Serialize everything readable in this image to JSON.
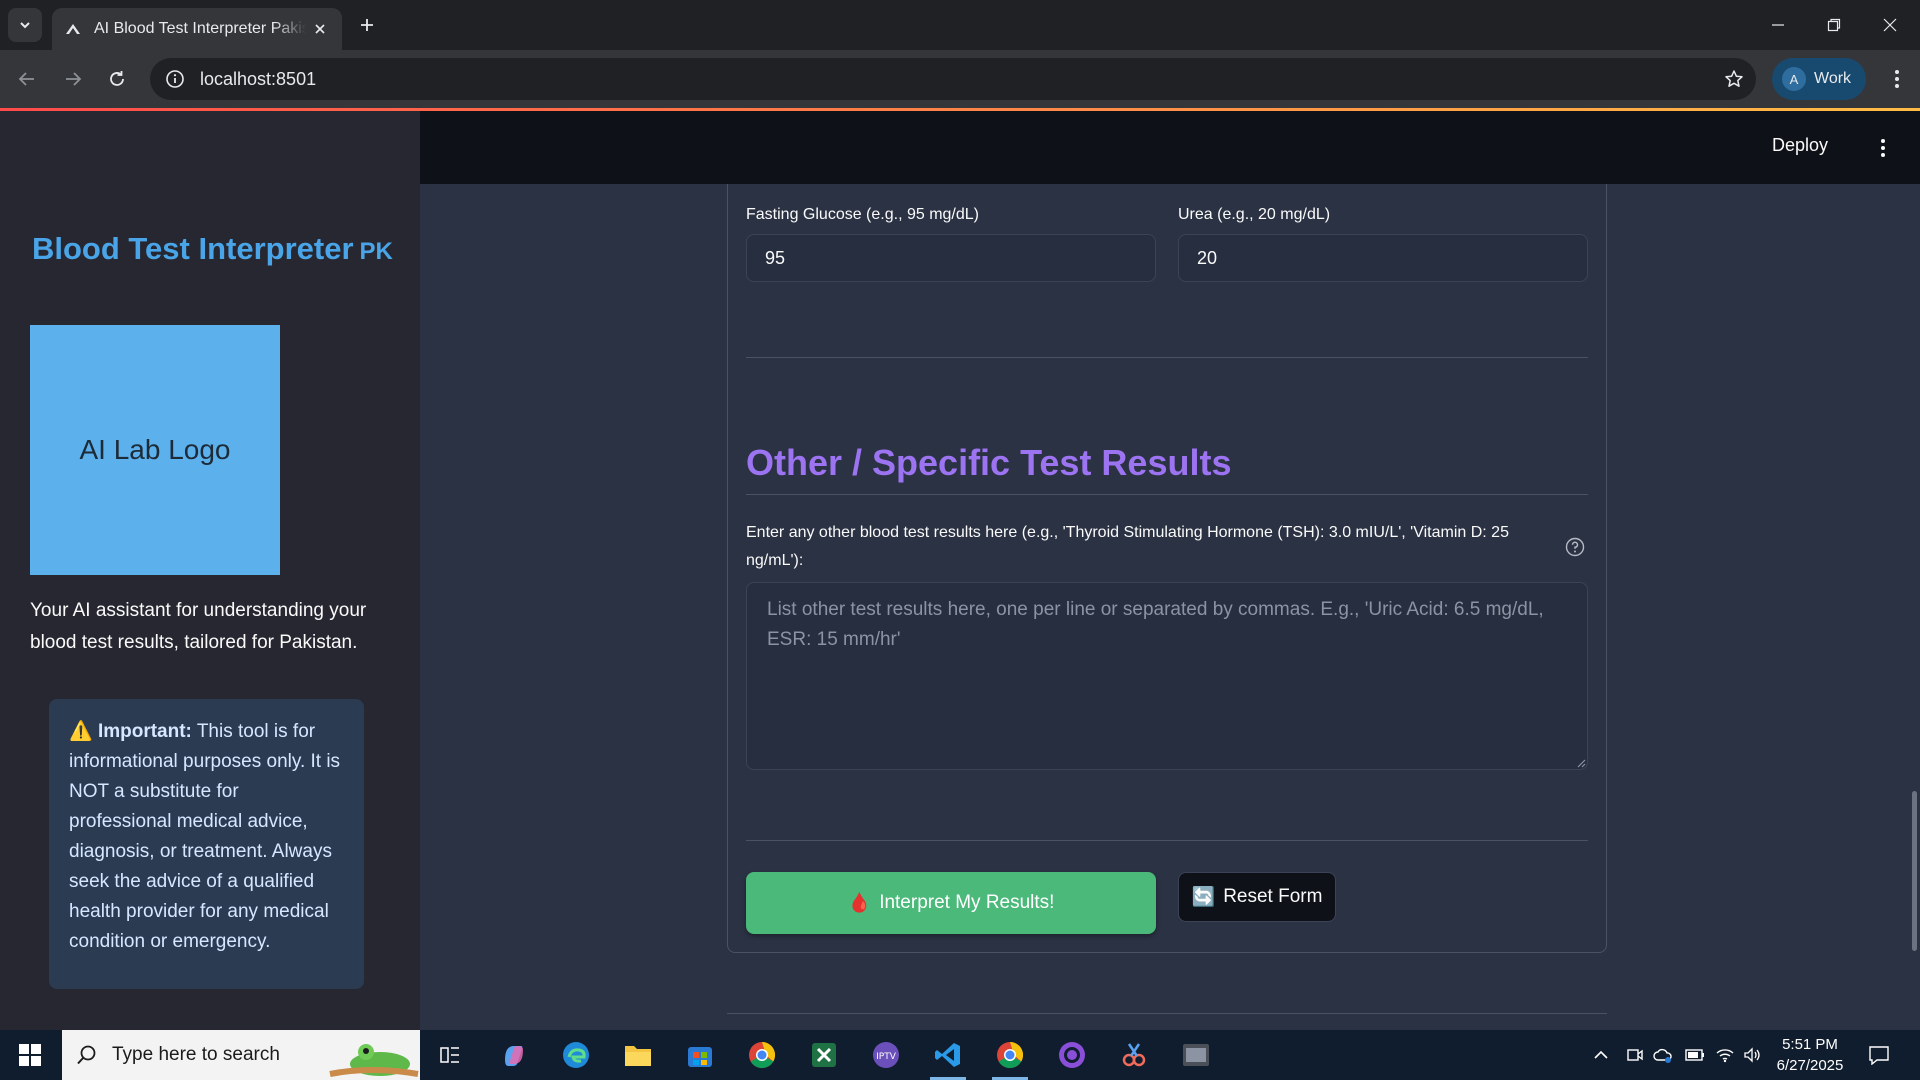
{
  "browser": {
    "tab_title": "AI Blood Test Interpreter Pakistan",
    "url": "localhost:8501",
    "profile_initial": "A",
    "profile_label": "Work"
  },
  "app_header": {
    "deploy_label": "Deploy"
  },
  "sidebar": {
    "title": "Blood Test Interpreter",
    "title_suffix": "PK",
    "logo_text": "AI Lab Logo",
    "description": "Your AI assistant for understanding your blood test results, tailored for Pakistan.",
    "warning_icon": "⚠️",
    "warning_bold": "Important:",
    "warning_text": "This tool is for informational purposes only. It is NOT a substitute for professional medical advice, diagnosis, or treatment. Always seek the advice of a qualified health provider for any medical condition or emergency."
  },
  "form": {
    "fasting_glucose_label": "Fasting Glucose (e.g., 95 mg/dL)",
    "fasting_glucose_value": "95",
    "urea_label": "Urea (e.g., 20 mg/dL)",
    "urea_value": "20",
    "other_section_title": "Other / Specific Test Results",
    "other_label": "Enter any other blood test results here (e.g., 'Thyroid Stimulating Hormone (TSH): 3.0 mIU/L', 'Vitamin D: 25 ng/mL'):",
    "other_placeholder": "List other test results here, one per line or separated by commas. E.g., 'Uric Acid: 6.5 mg/dL, ESR: 15 mm/hr'",
    "interpret_icon": "🩸",
    "interpret_label": "Interpret My Results!",
    "reset_icon": "🔄",
    "reset_label": "Reset Form"
  },
  "taskbar": {
    "search_placeholder": "Type here to search",
    "time": "5:51 PM",
    "date": "6/27/2025"
  },
  "colors": {
    "sidebar_title": "#4aa5e8",
    "logo_bg": "#5cb0ec",
    "section_title": "#9c73f0",
    "primary_button": "#4ab97a"
  }
}
